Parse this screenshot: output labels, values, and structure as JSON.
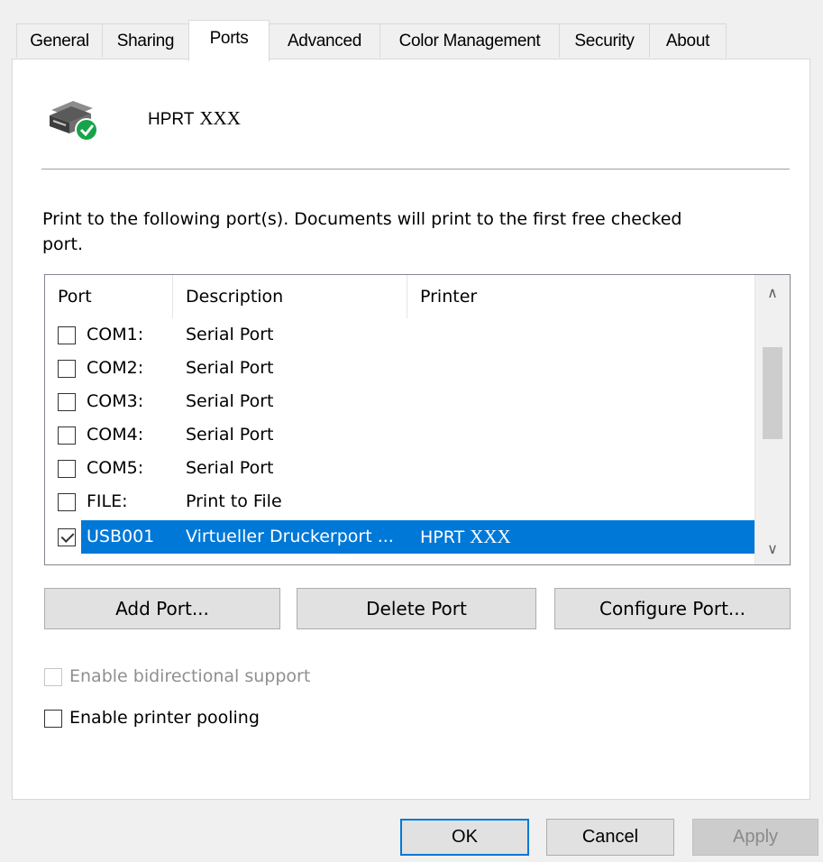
{
  "tabs": [
    {
      "label": "General"
    },
    {
      "label": "Sharing"
    },
    {
      "label": "Ports"
    },
    {
      "label": "Advanced"
    },
    {
      "label": "Color Management"
    },
    {
      "label": "Security"
    },
    {
      "label": "About"
    }
  ],
  "active_tab": "Ports",
  "printer": {
    "name_prefix": "HPRT",
    "model": "XXX",
    "icon": "printer-default-check-icon"
  },
  "intro_text": "Print to the following port(s). Documents will print to the first free checked port.",
  "ports_list": {
    "columns": [
      "Port",
      "Description",
      "Printer"
    ],
    "rows": [
      {
        "checked": false,
        "port": "COM1:",
        "description": "Serial Port",
        "printer": "",
        "printer_model": ""
      },
      {
        "checked": false,
        "port": "COM2:",
        "description": "Serial Port",
        "printer": "",
        "printer_model": ""
      },
      {
        "checked": false,
        "port": "COM3:",
        "description": "Serial Port",
        "printer": "",
        "printer_model": ""
      },
      {
        "checked": false,
        "port": "COM4:",
        "description": "Serial Port",
        "printer": "",
        "printer_model": ""
      },
      {
        "checked": false,
        "port": "COM5:",
        "description": "Serial Port",
        "printer": "",
        "printer_model": ""
      },
      {
        "checked": false,
        "port": "FILE:",
        "description": "Print to File",
        "printer": "",
        "printer_model": ""
      },
      {
        "checked": true,
        "port": "USB001",
        "description": "Virtueller Druckerport ...",
        "printer": "HPRT",
        "printer_model": "XXX",
        "selected": true
      }
    ],
    "scroll_up_icon": "chevron-up-icon",
    "scroll_down_icon": "chevron-down-icon"
  },
  "buttons": {
    "add_port": "Add Port...",
    "delete_port": "Delete Port",
    "configure_port": "Configure Port..."
  },
  "options": {
    "bidirectional": {
      "label": "Enable bidirectional support",
      "checked": false,
      "enabled": false
    },
    "pooling": {
      "label": "Enable printer pooling",
      "checked": false,
      "enabled": true
    }
  },
  "dialog_buttons": {
    "ok": "OK",
    "cancel": "Cancel",
    "apply": "Apply"
  },
  "colors": {
    "selection": "#0078d7",
    "window": "#f0f0f0",
    "panel": "#ffffff"
  }
}
